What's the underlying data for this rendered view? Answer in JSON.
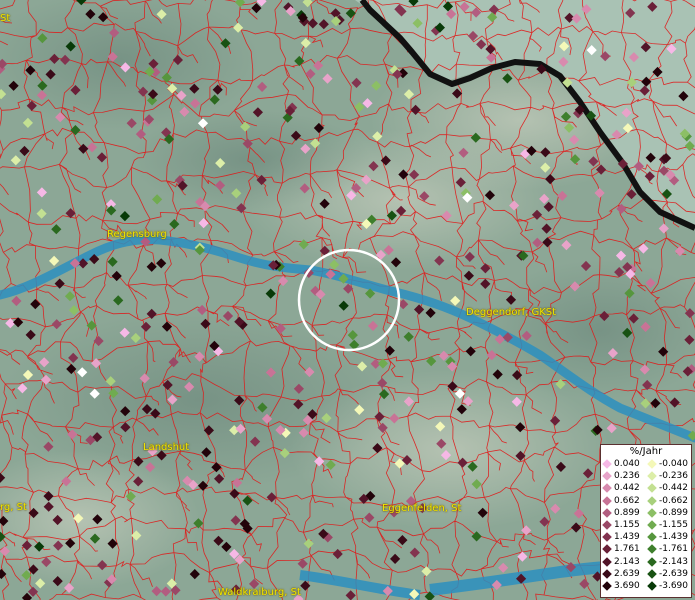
{
  "map": {
    "places": [
      {
        "id": "regensburg",
        "name": "Regensburg"
      },
      {
        "id": "deggendorf",
        "name": "Deggendorf, GKSt"
      },
      {
        "id": "landshut",
        "name": "Landshut"
      },
      {
        "id": "eggenfelden",
        "name": "Eggenfelden, St"
      },
      {
        "id": "waldkraiburg",
        "name": "Waldkraiburg, St"
      },
      {
        "id": "topleft",
        "name": "rg, St"
      },
      {
        "id": "leftedge",
        "name": "St"
      }
    ]
  },
  "legend": {
    "title": "%/Jahr",
    "positive_labels": [
      "0.040",
      "0.236",
      "0.442",
      "0.662",
      "0.899",
      "1.155",
      "1.439",
      "1.761",
      "2.143",
      "2.639",
      "3.690"
    ],
    "negative_labels": [
      "-0.040",
      "-0.236",
      "-0.442",
      "-0.662",
      "-0.899",
      "-1.155",
      "-1.439",
      "-1.761",
      "-2.143",
      "-2.639",
      "-3.690"
    ],
    "positive_colors": [
      "#f6b8e6",
      "#e8a3c9",
      "#d88aae",
      "#c87396",
      "#b25d80",
      "#9a4866",
      "#833450",
      "#6a2038",
      "#521428",
      "#3a0a18",
      "#22030a"
    ],
    "negative_colors": [
      "#f4f8b8",
      "#dceea8",
      "#c3e092",
      "#a8d07c",
      "#8cbf65",
      "#70ab50",
      "#56963d",
      "#3e7f2c",
      "#2a691f",
      "#185213",
      "#083a08"
    ]
  },
  "colors": {
    "terrain": "#8fa89a",
    "borders": "#e01818",
    "river": "#2c8fc0",
    "national_border": "#111111",
    "place_label": "#f2e600",
    "selection_circle": "#ffffff"
  }
}
